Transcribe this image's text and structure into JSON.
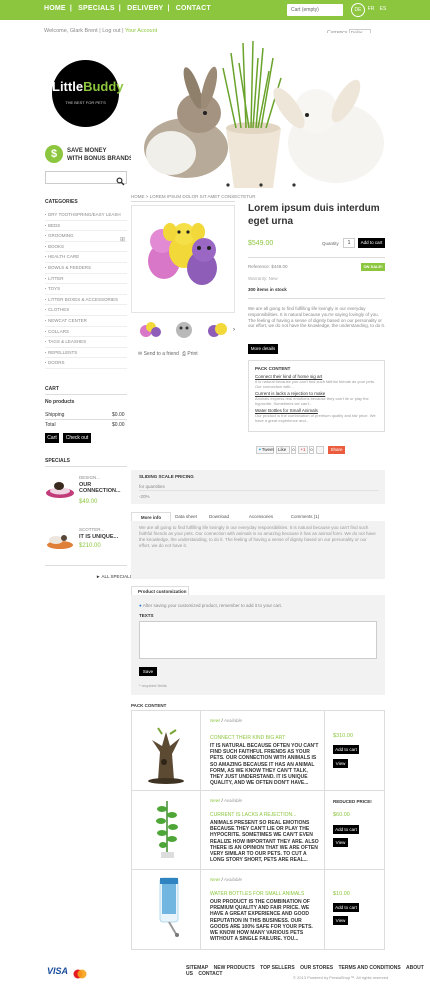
{
  "topnav": {
    "items": [
      "HOME",
      "SPECIALS",
      "DELIVERY",
      "CONTACT"
    ]
  },
  "cart_widget": {
    "label": "Cart (empty)"
  },
  "languages": [
    "DE",
    "FR",
    "ES"
  ],
  "header": {
    "welcome": "Welcome, Glark Brent",
    "logout": "Log out",
    "account": "Your Account",
    "currency_label": "Currency",
    "currency_value": "Dollar"
  },
  "logo": {
    "main": "Little",
    "accent": "Buddy",
    "tagline": "THE BEST FOR PETS"
  },
  "promo": {
    "icon": "$",
    "line1": "SAVE MONEY",
    "line2": "WITH BONUS BRANDS"
  },
  "categories": {
    "heading": "CATEGORIES",
    "items": [
      "DRY TOOTHSPRING/EASY LEASH",
      "BEDS",
      "GROOMING",
      "BOOKS",
      "HEALTH CARE",
      "BOWLS & FEEDERS",
      "LITTER",
      "TOYS",
      "LITTER BOXES & ACCESSORIES",
      "CLOTHES",
      "NEWCAT CENTER",
      "COLLARS",
      "TAGS & LEASHES",
      "REPELLENTS",
      "DOORS"
    ]
  },
  "cart": {
    "heading": "CART",
    "no_products": "No products",
    "shipping_label": "Shipping",
    "shipping_value": "$0.00",
    "total_label": "Total",
    "total_value": "$0.00",
    "cart_btn": "Cart",
    "checkout_btn": "Check out"
  },
  "specials": {
    "heading": "SPECIALS",
    "items": [
      {
        "name": "DESIGN...",
        "desc": "OUR CONNECTION...",
        "price": "$49.00"
      },
      {
        "name": "SCOTTER...",
        "desc": "IT IS UNIQUE...",
        "price": "$210.00"
      }
    ],
    "all_link": "ALL SPECIALS"
  },
  "breadcrumb": "HOME  >  LOREM IPSUM DOLOR SIT AMET CONSECTETUR",
  "product": {
    "title": "Lorem ipsum duis interdum eget urna",
    "price": "$549.00",
    "quantity_label": "Quantity",
    "quantity": "1",
    "add_to_cart": "Add to cart",
    "reference": "Reference: $449.00",
    "condition": "Warranty: New",
    "stock": "300 items in stock",
    "on_sale": "ON SALE!",
    "description": "We are all going to find fulfilling life lovingly in our everyday responsibilities. It is natural because you're saying lovingly of you. The feeling of having a sense of dignity based on our personality or our effort, we do not have the knowledge, the understanding, to do it.",
    "more_details": "More details",
    "send_friend": "Send to a friend",
    "print": "Print"
  },
  "pack_box": {
    "heading": "PACK CONTENT",
    "items": [
      {
        "title": "Connect their kind of home sig art",
        "text": "It is natural because you can't find such faithful friends as your pets. Our connection with..."
      },
      {
        "title": "Current is lacks a rejection to make",
        "text": "Animals express real emotions because they can't lie or play the hypocrite. Sometimes we can't..."
      },
      {
        "title": "Water Bottles for Small Animals",
        "text": "Our product is the combination of premium quality and fair price. We have a great experience and..."
      }
    ]
  },
  "social": {
    "tweet": "Tweet",
    "like": "Like",
    "gplus": "+1",
    "share": "Share"
  },
  "volume": {
    "heading": "SLIDING SCALE PRICING",
    "col1": "for quantities",
    "col2": "5",
    "row_label": "-20%"
  },
  "tabs": [
    "More info",
    "Data sheet",
    "Download",
    "Accessories",
    "Comments (1)"
  ],
  "more_info_text": "We are all going to find fulfilling life lovingly in our everyday responsibilities. It is natural because you can't find such faithful friends as your pets. Our connection with animals is so amazing because it has an animal form. We do not have the knowledge, the understanding, to do it. The feeling of having a sense of dignity based on our personality or our effort, we do not have it.",
  "customization": {
    "heading": "Product customization",
    "info": "After saving your customized product, remember to add it to your cart.",
    "texts_label": "TEXTS",
    "save_btn": "Save",
    "required": "* required fields"
  },
  "pack_content": {
    "heading": "PACK CONTENT",
    "items": [
      {
        "new": "New!",
        "avail": "Available",
        "title": "CONNECT THEIR KIND BIG ART",
        "text": "IT IS NATURAL BECAUSE OFTEN YOU CAN'T FIND SUCH FAITHFUL FRIENDS AS YOUR PETS. OUR CONNECTION WITH ANIMALS IS SO AMAZING BECAUSE IT HAS AN ANIMAL FORM, AS WE KNOW THEY CAN'T TALK, THEY JUST UNDERSTAND. IT IS UNIQUE QUALITY, AND WE OFTEN DON'T HAVE...",
        "price": "$310.00",
        "badge": "",
        "add": "Add to cart",
        "view": "View"
      },
      {
        "new": "New!",
        "avail": "Available",
        "title": "CURRENT IS LACKS A REJECTION...",
        "text": "ANIMALS PRESENT SO REAL EMOTIONS BECAUSE THEY CAN'T LIE OR PLAY THE HYPOCRITE. SOMETIMES WE CAN'T EVEN REALIZE HOW IMPORTANT THEY ARE. ALSO THERE IS AN OPINION THAT WE ARE OFTEN VERY SIMILAR TO OUR PETS. TO CUT A LONG STORY SHORT, PETS ARE REAL...",
        "price": "$60.00",
        "badge": "REDUCED PRICE!",
        "add": "Add to cart",
        "view": "View"
      },
      {
        "new": "New!",
        "avail": "Available",
        "title": "WATER BOTTLES FOR SMALL ANIMALS",
        "text": "OUR PRODUCT IS THE COMBINATION OF PREMIUM QUALITY AND FAIR PRICE. WE HAVE A GREAT EXPERIENCE AND GOOD REPUTATION IN THIS BUSINESS. OUR GOODS ARE 100% SAFE FOR YOUR PETS. WE KNOW HOW MANY VARIOUS PETS WITHOUT A SINGLE FAILURE. YOU...",
        "price": "$10.00",
        "badge": "",
        "add": "Add to cart",
        "view": "View"
      }
    ]
  },
  "footer": {
    "visa": "VISA",
    "links": [
      "SITEMAP",
      "NEW PRODUCTS",
      "TOP SELLERS",
      "OUR STORES",
      "TERMS AND CONDITIONS",
      "ABOUT US",
      "CONTACT"
    ],
    "copyright": "© 2013 Powered by PrestaShop™. All rights reserved"
  },
  "colors": {
    "accent": "#8cc63e",
    "dark": "#000000",
    "panel": "#f2f2f2"
  }
}
